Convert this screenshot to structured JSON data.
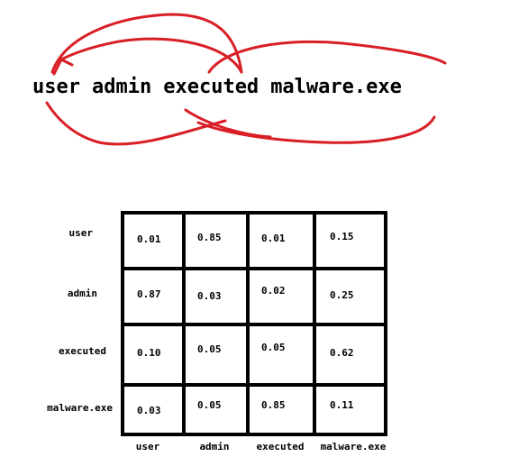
{
  "sentence": {
    "words": [
      "user",
      "admin",
      "executed",
      "malware.exe"
    ]
  },
  "colors": {
    "scribble": "#d91f26",
    "grid": "#000000"
  },
  "attention": {
    "row_labels": [
      "user",
      "admin",
      "executed",
      "malware.exe"
    ],
    "col_labels": [
      "user",
      "admin",
      "executed",
      "malware.exe"
    ],
    "values": [
      [
        "0.01",
        "0.85",
        "0.01",
        "0.15"
      ],
      [
        "0.87",
        "0.03",
        "0.02",
        "0.25"
      ],
      [
        "0.10",
        "0.05",
        "0.05",
        "0.62"
      ],
      [
        "0.03",
        "0.05",
        "0.85",
        "0.11"
      ]
    ]
  }
}
